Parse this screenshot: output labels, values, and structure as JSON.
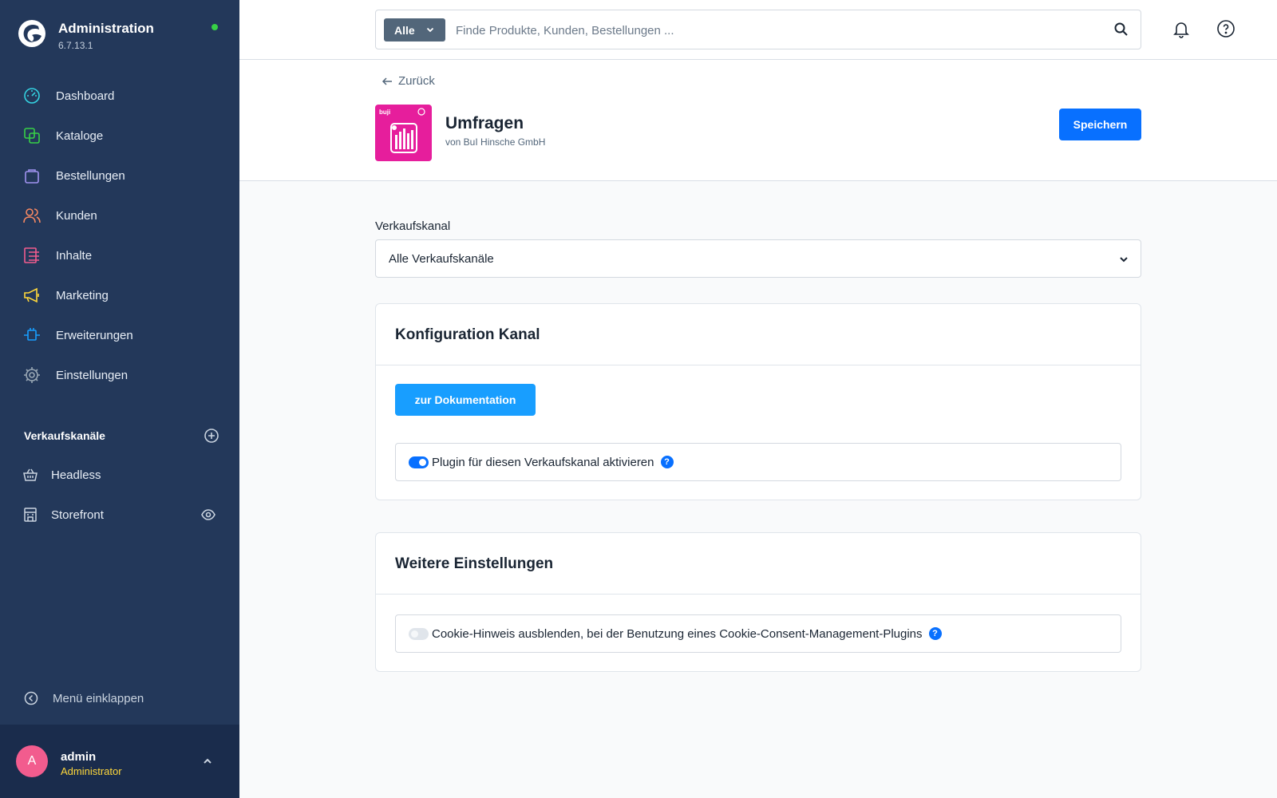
{
  "brand": {
    "title": "Administration",
    "version": "6.7.13.1"
  },
  "nav": {
    "items": [
      {
        "label": "Dashboard",
        "icon": "dashboard-icon",
        "color": "#34d1e0"
      },
      {
        "label": "Kataloge",
        "icon": "catalog-icon",
        "color": "#37d046"
      },
      {
        "label": "Bestellungen",
        "icon": "shopping-bag-icon",
        "color": "#a092f0"
      },
      {
        "label": "Kunden",
        "icon": "customers-icon",
        "color": "#f88962"
      },
      {
        "label": "Inhalte",
        "icon": "content-icon",
        "color": "#f25c8e"
      },
      {
        "label": "Marketing",
        "icon": "megaphone-icon",
        "color": "#ffd83b"
      },
      {
        "label": "Erweiterungen",
        "icon": "plug-icon",
        "color": "#189eff"
      },
      {
        "label": "Einstellungen",
        "icon": "gear-icon",
        "color": "#9aa8b5"
      }
    ]
  },
  "sales_channels": {
    "title": "Verkaufskanäle",
    "items": [
      {
        "label": "Headless",
        "icon": "basket-icon"
      },
      {
        "label": "Storefront",
        "icon": "storefront-icon"
      }
    ]
  },
  "collapse_label": "Menü einklappen",
  "user": {
    "initial": "A",
    "name": "admin",
    "role": "Administrator"
  },
  "search": {
    "type_label": "Alle",
    "placeholder": "Finde Produkte, Kunden, Bestellungen ..."
  },
  "header": {
    "back_label": "Zurück",
    "plugin_name": "Umfragen",
    "vendor": "von BuI Hinsche GmbH",
    "logo_text": "buji",
    "save_label": "Speichern"
  },
  "sales_channel_select": {
    "label": "Verkaufskanal",
    "value": "Alle Verkaufskanäle"
  },
  "card_channel": {
    "title": "Konfiguration Kanal",
    "doc_button": "zur Dokumentation",
    "setting_label": "Plugin für diesen Verkaufskanal aktivieren",
    "enabled": true
  },
  "card_more": {
    "title": "Weitere Einstellungen",
    "setting_label": "Cookie-Hinweis ausblenden, bei der Benutzung eines Cookie-Consent-Management-Plugins",
    "enabled": false
  },
  "colors": {
    "sidebar": "#23385a",
    "primary": "#0870ff",
    "doc_button": "#189eff",
    "online": "#37d046"
  }
}
